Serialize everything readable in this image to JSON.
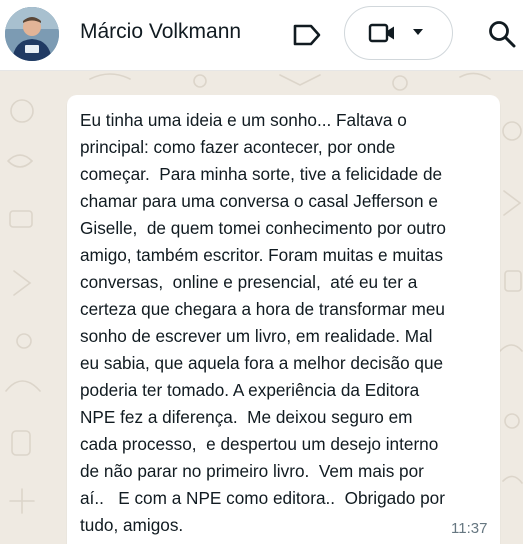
{
  "header": {
    "contact_name": "Márcio Volkmann",
    "avatar_icon": "profile-photo",
    "label_icon": "label-icon",
    "video_icon": "video-camera-icon",
    "dropdown_icon": "caret-down-icon",
    "search_icon": "search-icon"
  },
  "message": {
    "text": "Eu tinha uma ideia e um sonho... Faltava o\nprincipal: como fazer acontecer, por onde\ncomeçar.  Para minha sorte, tive a felicidade de\nchamar para uma conversa o casal Jefferson e\nGiselle,  de quem tomei conhecimento por outro\namigo, também escritor. Foram muitas e muitas\nconversas,  online e presencial,  até eu ter a\ncerteza que chegara a hora de transformar meu\nsonho de escrever um livro, em realidade. Mal\neu sabia, que aquela fora a melhor decisão que\npoderia ter tomado. A experiência da Editora\nNPE fez a diferença.  Me deixou seguro em\ncada processo,  e despertou um desejo interno\nde não parar no primeiro livro.  Vem mais por\naí..   E com a NPE como editora..  Obrigado por\ntudo, amigos.",
    "time": "11:37"
  },
  "colors": {
    "chat_background": "#efeae2",
    "bubble": "#ffffff",
    "text": "#111b21",
    "meta": "#667781",
    "icon": "#111b21"
  }
}
